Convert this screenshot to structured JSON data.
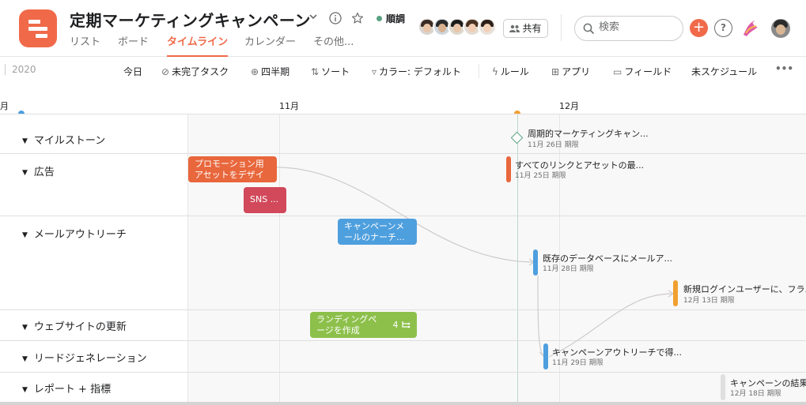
{
  "project": {
    "title": "定期マーケティングキャンペーン",
    "status": "順調",
    "status_color": "#58a182",
    "brand_color": "#f06a4a"
  },
  "tabs": [
    {
      "label": "リスト",
      "active": false
    },
    {
      "label": "ボード",
      "active": false
    },
    {
      "label": "タイムライン",
      "active": true
    },
    {
      "label": "カレンダー",
      "active": false
    },
    {
      "label": "その他...",
      "active": false
    }
  ],
  "header_right": {
    "share_label": "共有",
    "search_placeholder": "検索",
    "plus_label": "+",
    "help_label": "?"
  },
  "icons": {
    "dropdown": "chevron-down-icon",
    "info": "info-icon",
    "star": "star-icon",
    "share": "people-icon",
    "search": "search-icon",
    "more": "more-horizontal-icon"
  },
  "toolbar": {
    "year": "2020",
    "today": "今日",
    "incomplete": "未完了タスク",
    "quarter": "四半期",
    "sort": "ソート",
    "color": "カラー: デフォルト",
    "rules": "ルール",
    "apps": "アプリ",
    "fields": "フィールド",
    "unscheduled": "未スケジュール",
    "more": "•••"
  },
  "timescale": {
    "left_fragment": "月",
    "nov": "11月",
    "dec": "12月"
  },
  "sections": [
    {
      "label": "マイルストーン"
    },
    {
      "label": "広告"
    },
    {
      "label": "メールアウトリーチ"
    },
    {
      "label": "ウェブサイトの更新"
    },
    {
      "label": "リードジェネレーション"
    },
    {
      "label": "レポート + 指標"
    }
  ],
  "tasks": {
    "milestone": {
      "name": "周期的マーケティングキャン...",
      "due": "11月 26日 期限"
    },
    "ad_promo": {
      "name": "プロモーション用アセットをデザイン"
    },
    "ad_sns": {
      "name": "SNS ..."
    },
    "ad_links": {
      "name": "すべてのリンクとアセットの最...",
      "due": "11月 25日 期限"
    },
    "email_campaign": {
      "name": "キャンペーンメールのナーチ..."
    },
    "email_db": {
      "name": "既存のデータベースにメールア...",
      "due": "11月 28日 期限"
    },
    "email_login": {
      "name": "新規ログインユーザーに、フラ...",
      "due": "12月 13日 期限"
    },
    "web_landing": {
      "name": "ランディングページを作成",
      "subtasks": "4"
    },
    "lead_outreach": {
      "name": "キャンペーンアウトリーチで得...",
      "due": "11月 29日 期限"
    },
    "report_result": {
      "name": "キャンペーンの結果...",
      "due": "12月 18日 期限"
    }
  },
  "colors": {
    "orange": "#e8673c",
    "red": "#d1495b",
    "blue": "#4e9fde",
    "green": "#8dc04b",
    "amber": "#f0a030"
  }
}
